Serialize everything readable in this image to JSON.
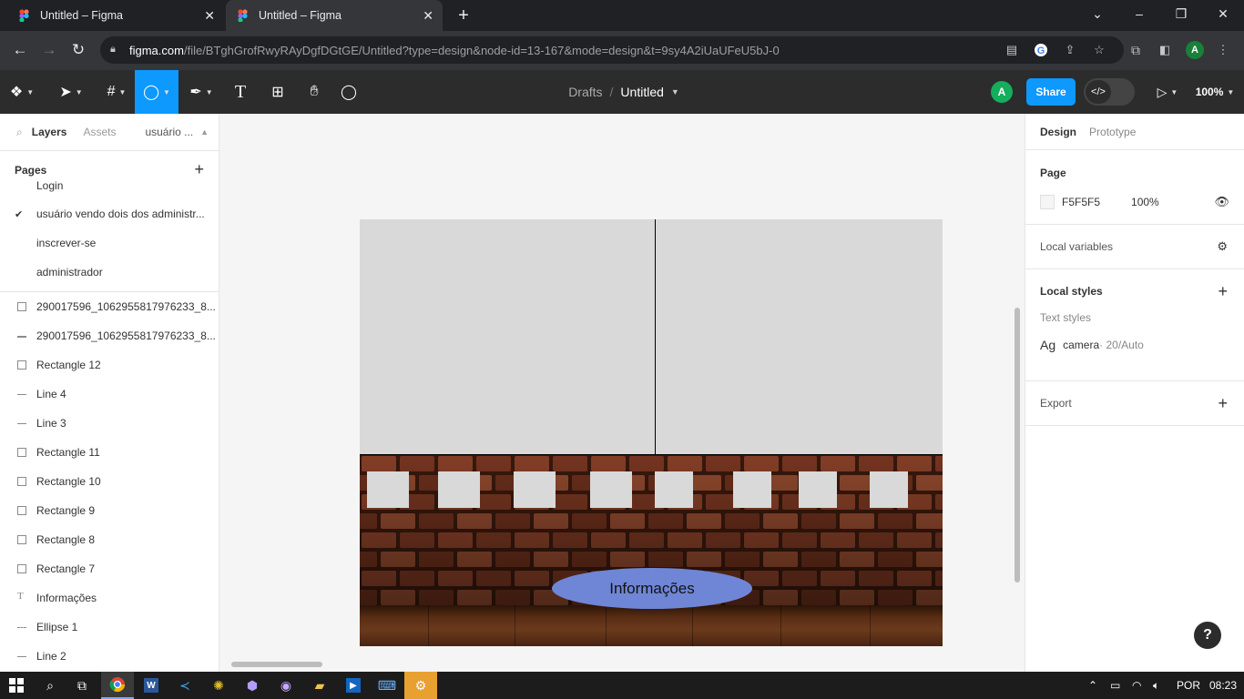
{
  "browser": {
    "tabs": [
      {
        "title": "Untitled – Figma",
        "active": false
      },
      {
        "title": "Untitled – Figma",
        "active": true
      }
    ],
    "new_tab_icon": "plus-icon",
    "window_controls": [
      "chevron-down-icon",
      "minimize-icon",
      "restore-icon",
      "close-icon"
    ],
    "url_host": "figma.com",
    "url_path": "/file/BTghGrofRwyRAyDgfDGtGE/Untitled?type=design&node-id=13-167&mode=design&t=9sy4A2iUaUFeU5bJ-0",
    "profile_initial": "A"
  },
  "figma": {
    "breadcrumb_parent": "Drafts",
    "breadcrumb_file": "Untitled",
    "avatar_initial": "A",
    "share_label": "Share",
    "zoom_label": "100%",
    "active_tool": "ellipse",
    "left_tabs": {
      "layers": "Layers",
      "assets": "Assets",
      "page_select": "usuário ..."
    },
    "pages_label": "Pages",
    "pages": [
      {
        "name": "Login",
        "current": false
      },
      {
        "name": "usuário vendo dois dos administr...",
        "current": true
      },
      {
        "name": "inscrever-se",
        "current": false
      },
      {
        "name": "administrador",
        "current": false
      }
    ],
    "layers": [
      {
        "name": "290017596_1062955817976233_8...",
        "type": "rect"
      },
      {
        "name": "290017596_1062955817976233_8...",
        "type": "line"
      },
      {
        "name": "Rectangle 12",
        "type": "rect"
      },
      {
        "name": "Line 4",
        "type": "line"
      },
      {
        "name": "Line 3",
        "type": "line"
      },
      {
        "name": "Rectangle 11",
        "type": "rect"
      },
      {
        "name": "Rectangle 10",
        "type": "rect"
      },
      {
        "name": "Rectangle 9",
        "type": "rect"
      },
      {
        "name": "Rectangle 8",
        "type": "rect"
      },
      {
        "name": "Rectangle 7",
        "type": "rect"
      },
      {
        "name": "Informações",
        "type": "text"
      },
      {
        "name": "Ellipse 1",
        "type": "ellipse"
      },
      {
        "name": "Line 2",
        "type": "line"
      }
    ],
    "right_tabs": {
      "design": "Design",
      "prototype": "Prototype"
    },
    "page_section": {
      "title": "Page",
      "color_hex": "F5F5F5",
      "opacity": "100%"
    },
    "local_variables": "Local variables",
    "local_styles": "Local styles",
    "text_styles_label": "Text styles",
    "text_style": {
      "preview": "Ag",
      "name": "camera",
      "meta": " · 20/Auto"
    },
    "export_label": "Export",
    "canvas_ellipse_text": "Informações",
    "help_label": "?"
  },
  "taskbar": {
    "language": "POR",
    "time": "08:23"
  },
  "colors": {
    "figma_blue": "#0d99ff",
    "figma_dark": "#2c2c2c",
    "ellipse_fill": "#6f86d6",
    "avatar_green": "#14ae5c"
  }
}
